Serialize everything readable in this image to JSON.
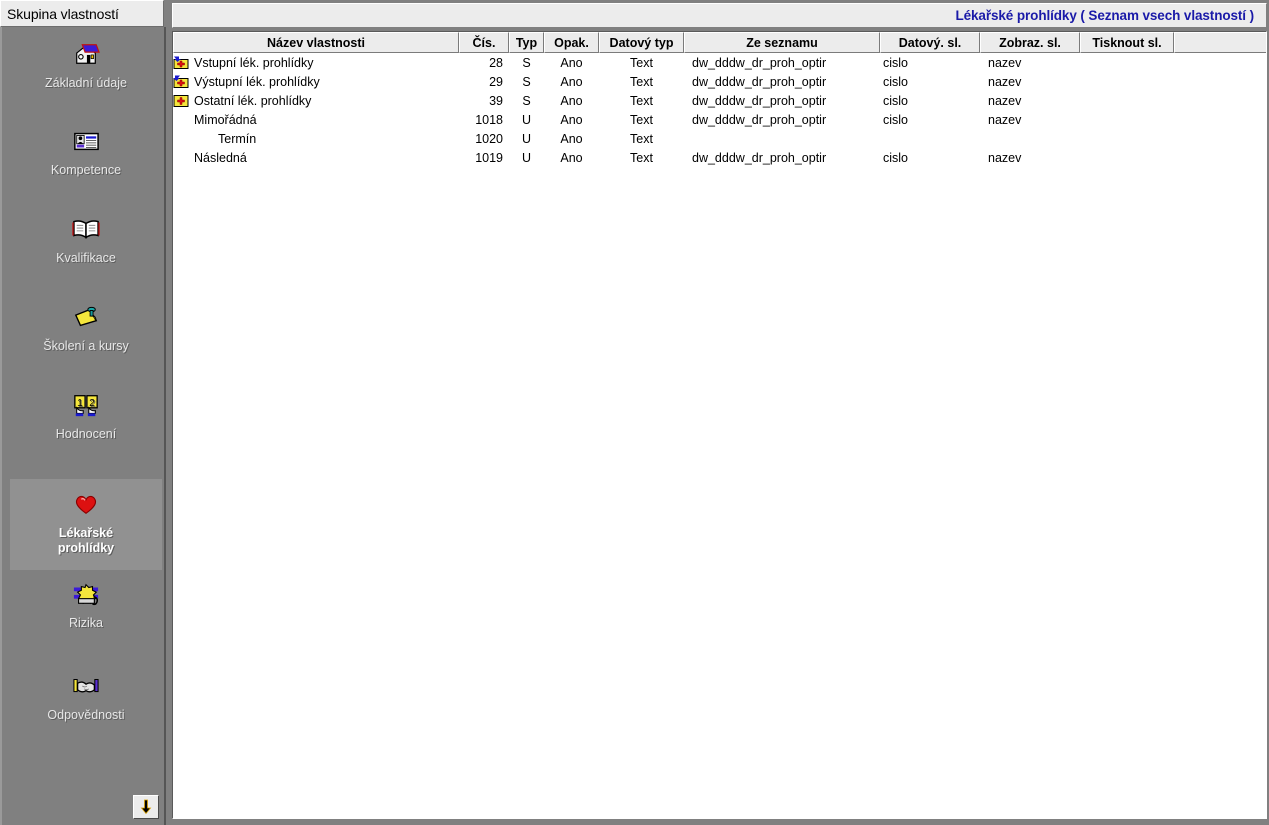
{
  "sidebar": {
    "tab_label": "Skupina vlastností",
    "scroll_down_icon": "arrow-down-icon",
    "items": [
      {
        "label": "Základní údaje",
        "icon": "house-icon",
        "selected": false
      },
      {
        "label": "Kompetence",
        "icon": "id-card-icon",
        "selected": false
      },
      {
        "label": "Kvalifikace",
        "icon": "open-book-icon",
        "selected": false
      },
      {
        "label": "Školení a kursy",
        "icon": "note-pin-icon",
        "selected": false
      },
      {
        "label": "Hodnocení",
        "icon": "rating-cards-icon",
        "selected": false
      },
      {
        "label": "Lékařské\nprohlídky",
        "icon": "heart-icon",
        "selected": true
      },
      {
        "label": "Rizika",
        "icon": "gear-wrench-icon",
        "selected": false
      },
      {
        "label": "Odpovědnosti",
        "icon": "handshake-icon",
        "selected": false
      }
    ]
  },
  "content": {
    "title": "Lékařské prohlídky  ( Seznam vsech vlastností )",
    "title_color": "#1a1aa8",
    "columns": [
      {
        "key": "name",
        "label": "Název vlastnosti"
      },
      {
        "key": "num",
        "label": "Čís."
      },
      {
        "key": "typ",
        "label": "Typ"
      },
      {
        "key": "opak",
        "label": "Opak."
      },
      {
        "key": "dtyp",
        "label": "Datový typ"
      },
      {
        "key": "seznam",
        "label": "Ze seznamu"
      },
      {
        "key": "dsl",
        "label": "Datový. sl."
      },
      {
        "key": "zsl",
        "label": "Zobraz. sl."
      },
      {
        "key": "tsl",
        "label": "Tisknout sl."
      },
      {
        "key": "filler",
        "label": ""
      }
    ],
    "rows": [
      {
        "icon": "medical-in-icon",
        "indent": 0,
        "name": "Vstupní lék. prohlídky",
        "num": "28",
        "typ": "S",
        "opak": "Ano",
        "dtyp": "Text",
        "seznam": "dw_dddw_dr_proh_optir",
        "dsl": "cislo",
        "zsl": "nazev",
        "tsl": ""
      },
      {
        "icon": "medical-out-icon",
        "indent": 0,
        "name": "Výstupní lék. prohlídky",
        "num": "29",
        "typ": "S",
        "opak": "Ano",
        "dtyp": "Text",
        "seznam": "dw_dddw_dr_proh_optir",
        "dsl": "cislo",
        "zsl": "nazev",
        "tsl": ""
      },
      {
        "icon": "medical-icon",
        "indent": 0,
        "name": "Ostatní lék. prohlídky",
        "num": "39",
        "typ": "S",
        "opak": "Ano",
        "dtyp": "Text",
        "seznam": "dw_dddw_dr_proh_optir",
        "dsl": "cislo",
        "zsl": "nazev",
        "tsl": ""
      },
      {
        "icon": "",
        "indent": 1,
        "name": "Mimořádná",
        "num": "1018",
        "typ": "U",
        "opak": "Ano",
        "dtyp": "Text",
        "seznam": "dw_dddw_dr_proh_optir",
        "dsl": "cislo",
        "zsl": "nazev",
        "tsl": ""
      },
      {
        "icon": "",
        "indent": 2,
        "name": "Termín",
        "num": "1020",
        "typ": "U",
        "opak": "Ano",
        "dtyp": "Text",
        "seznam": "",
        "dsl": "",
        "zsl": "",
        "tsl": ""
      },
      {
        "icon": "",
        "indent": 1,
        "name": "Následná",
        "num": "1019",
        "typ": "U",
        "opak": "Ano",
        "dtyp": "Text",
        "seznam": "dw_dddw_dr_proh_optir",
        "dsl": "cislo",
        "zsl": "nazev",
        "tsl": ""
      }
    ]
  }
}
